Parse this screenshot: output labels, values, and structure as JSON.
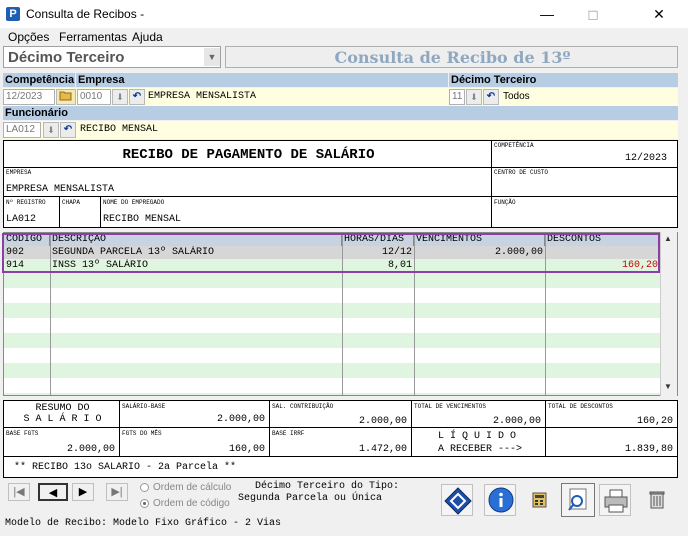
{
  "window": {
    "title": "Consulta de Recibos -",
    "icon_letter": "P"
  },
  "menu": [
    "Opções",
    "Ferramentas",
    "Ajuda"
  ],
  "type_select": {
    "value": "Décimo Terceiro"
  },
  "header_title": "Consulta de Recibo de 13º",
  "filters": {
    "competencia_label": "Competência",
    "empresa_label": "Empresa",
    "decimo_label": "Décimo Terceiro",
    "funcionario_label": "Funcionário",
    "competencia_value": "12/2023",
    "empresa_code": "0010",
    "empresa_name": "EMPRESA MENSALISTA",
    "decimo_code": "11",
    "decimo_name": "Todos",
    "funcionario_code": "LA012",
    "funcionario_name": "RECIBO MENSAL"
  },
  "receipt": {
    "title": "RECIBO DE PAGAMENTO DE SALÁRIO",
    "competencia_label": "COMPETÊNCIA",
    "competencia_value": "12/2023",
    "empresa_label": "EMPRESA",
    "empresa_value": "EMPRESA MENSALISTA",
    "centro_label": "CENTRO DE CUSTO",
    "registro_label": "Nº REGISTRO",
    "registro_value": "LA012",
    "chapa_label": "CHAPA",
    "empregado_label": "NOME DO EMPREGADO",
    "empregado_value": "RECIBO MENSAL",
    "funcao_label": "FUNÇÃO"
  },
  "grid": {
    "headers": [
      "CÓDIGO",
      "DESCRIÇÃO",
      "HORAS/DIAS",
      "VENCIMENTOS",
      "DESCONTOS"
    ],
    "rows": [
      {
        "codigo": "902",
        "descricao": "SEGUNDA PARCELA 13º SALÁRIO",
        "horas": "12/12",
        "vencimentos": "2.000,00",
        "descontos": ""
      },
      {
        "codigo": "914",
        "descricao": "INSS 13º SALÁRIO",
        "horas": "8,01",
        "vencimentos": "",
        "descontos": "160,20"
      }
    ]
  },
  "summary": {
    "resumo_line1": "RESUMO DO",
    "resumo_line2": "S A L Á R I O",
    "salario_base_label": "SALÁRIO-BASE",
    "salario_base_value": "2.000,00",
    "sal_contrib_label": "SAL. CONTRIBUIÇÃO",
    "sal_contrib_value": "2.000,00",
    "total_venc_label": "TOTAL DE VENCIMENTOS",
    "total_venc_value": "2.000,00",
    "total_desc_label": "TOTAL DE DESCONTOS",
    "total_desc_value": "160,20",
    "base_fgts_label": "BASE FGTS",
    "base_fgts_value": "2.000,00",
    "fgts_mes_label": "FGTS DO MÊS",
    "fgts_mes_value": "160,00",
    "base_irrf_label": "BASE IRRF",
    "base_irrf_value": "1.472,00",
    "liquido_line1": "L Í Q U I D O",
    "liquido_line2": "A RECEBER --->",
    "liquido_value": "1.839,80"
  },
  "note": "** RECIBO 13o SALARIO - 2a Parcela **",
  "bottom": {
    "radio_calculo": "Ordem de cálculo",
    "radio_codigo": "Ordem de código",
    "tipo_line1": "Décimo Terceiro do Tipo:",
    "tipo_line2": "Segunda Parcela ou Única",
    "modelo": "Modelo de Recibo: Modelo Fixo Gráfico - 2 Vias"
  },
  "colors": {
    "accent_purple": "#8c3ea8",
    "red_value": "#cc0000",
    "stripe_green": "#dff5df",
    "label_blue": "#b7cde4"
  },
  "icons": [
    "app-icon",
    "folder-icon",
    "down-arrow-icon",
    "undo-arrow-icon",
    "first-icon",
    "prev-icon",
    "next-icon",
    "last-icon",
    "diamond-icon",
    "info-icon",
    "calculator-icon",
    "preview-icon",
    "printer-icon",
    "trash-icon"
  ]
}
